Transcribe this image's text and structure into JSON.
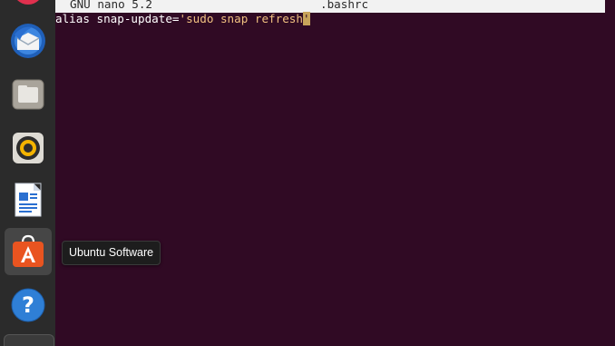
{
  "nano": {
    "version": "GNU nano 5.2",
    "filename": ".bashrc"
  },
  "editor": {
    "line_prefix": "alias snap-update=",
    "line_string": "'sudo snap refresh",
    "cursor_char": "'"
  },
  "dock": {
    "items": [
      {
        "icon": "app-icon-partial"
      },
      {
        "icon": "thunderbird-icon"
      },
      {
        "icon": "files-icon"
      },
      {
        "icon": "rhythmbox-icon"
      },
      {
        "icon": "libreoffice-writer-icon"
      },
      {
        "icon": "ubuntu-software-icon"
      },
      {
        "icon": "help-icon"
      }
    ]
  },
  "tooltip": {
    "text": "Ubuntu Software"
  },
  "colors": {
    "terminal_bg": "#300a24",
    "dock_bg": "#2b2b2b",
    "accent_orange": "#e95420"
  }
}
